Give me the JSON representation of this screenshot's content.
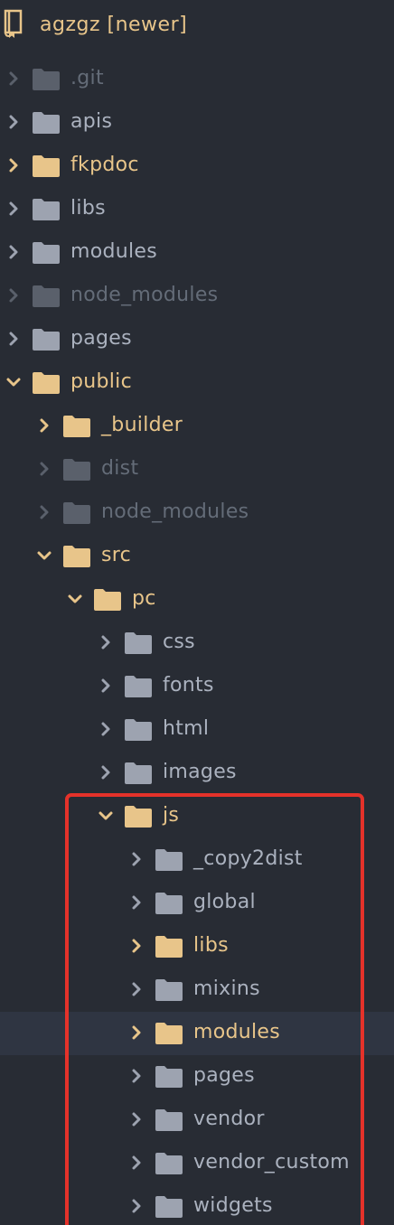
{
  "project": {
    "title": "agzgz [newer]",
    "icon": "repository-book-icon"
  },
  "colors": {
    "background": "#282c34",
    "selected_row": "#2f3542",
    "text_normal": "#abb2bf",
    "text_modified": "#e8c58a",
    "text_ignored": "#646c78",
    "highlight": "#e5322a"
  },
  "tree": [
    {
      "label": ".git",
      "depth": 0,
      "expanded": false,
      "status": "ignored"
    },
    {
      "label": "apis",
      "depth": 0,
      "expanded": false,
      "status": "normal"
    },
    {
      "label": "fkpdoc",
      "depth": 0,
      "expanded": false,
      "status": "modified"
    },
    {
      "label": "libs",
      "depth": 0,
      "expanded": false,
      "status": "normal"
    },
    {
      "label": "modules",
      "depth": 0,
      "expanded": false,
      "status": "normal"
    },
    {
      "label": "node_modules",
      "depth": 0,
      "expanded": false,
      "status": "ignored"
    },
    {
      "label": "pages",
      "depth": 0,
      "expanded": false,
      "status": "normal"
    },
    {
      "label": "public",
      "depth": 0,
      "expanded": true,
      "status": "modified"
    },
    {
      "label": "_builder",
      "depth": 1,
      "expanded": false,
      "status": "modified"
    },
    {
      "label": "dist",
      "depth": 1,
      "expanded": false,
      "status": "ignored"
    },
    {
      "label": "node_modules",
      "depth": 1,
      "expanded": false,
      "status": "ignored"
    },
    {
      "label": "src",
      "depth": 1,
      "expanded": true,
      "status": "modified"
    },
    {
      "label": "pc",
      "depth": 2,
      "expanded": true,
      "status": "modified"
    },
    {
      "label": "css",
      "depth": 3,
      "expanded": false,
      "status": "normal"
    },
    {
      "label": "fonts",
      "depth": 3,
      "expanded": false,
      "status": "normal"
    },
    {
      "label": "html",
      "depth": 3,
      "expanded": false,
      "status": "normal"
    },
    {
      "label": "images",
      "depth": 3,
      "expanded": false,
      "status": "normal"
    },
    {
      "label": "js",
      "depth": 3,
      "expanded": true,
      "status": "modified"
    },
    {
      "label": "_copy2dist",
      "depth": 4,
      "expanded": false,
      "status": "normal"
    },
    {
      "label": "global",
      "depth": 4,
      "expanded": false,
      "status": "normal"
    },
    {
      "label": "libs",
      "depth": 4,
      "expanded": false,
      "status": "modified"
    },
    {
      "label": "mixins",
      "depth": 4,
      "expanded": false,
      "status": "normal"
    },
    {
      "label": "modules",
      "depth": 4,
      "expanded": false,
      "status": "modified",
      "selected": true
    },
    {
      "label": "pages",
      "depth": 4,
      "expanded": false,
      "status": "normal"
    },
    {
      "label": "vendor",
      "depth": 4,
      "expanded": false,
      "status": "normal"
    },
    {
      "label": "vendor_custom",
      "depth": 4,
      "expanded": false,
      "status": "normal"
    },
    {
      "label": "widgets",
      "depth": 4,
      "expanded": false,
      "status": "normal"
    }
  ]
}
